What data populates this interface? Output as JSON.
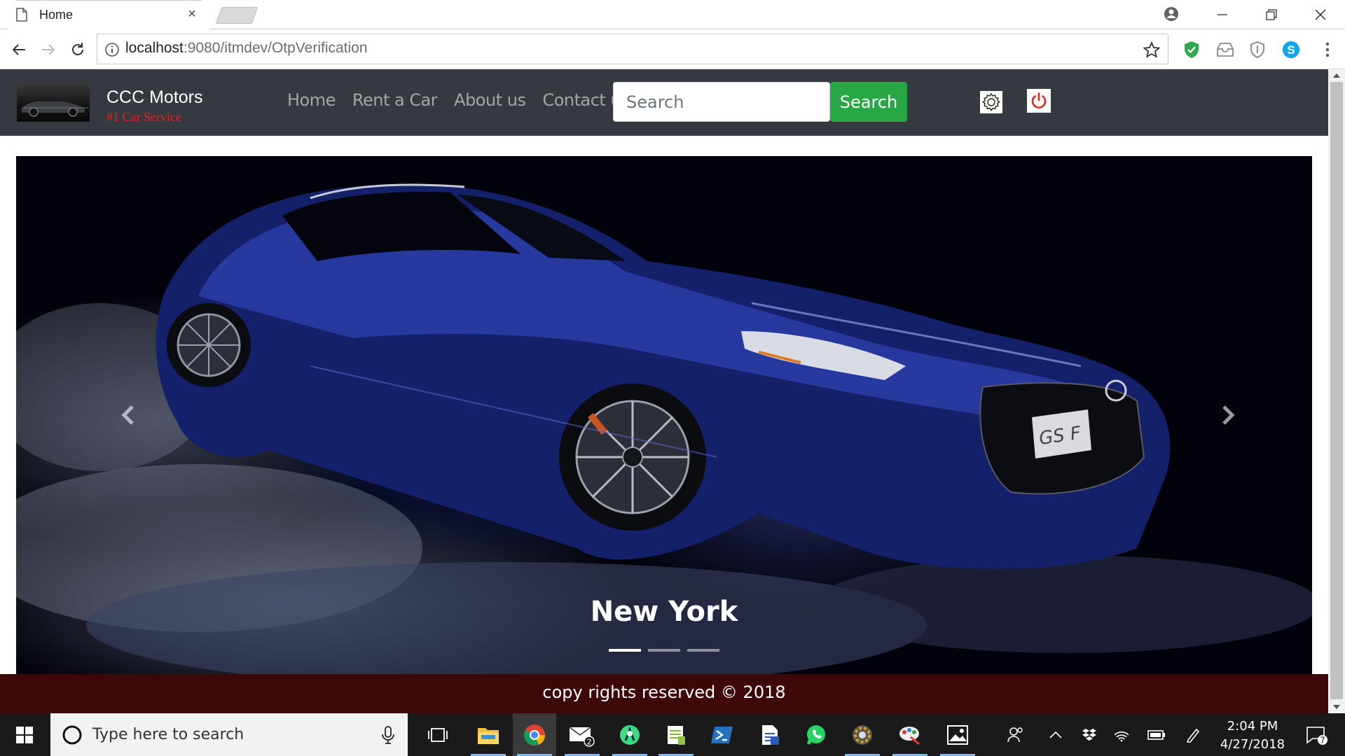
{
  "browser": {
    "tab_title": "Home",
    "tab_close": "×",
    "url_host": "localhost",
    "url_rest": ":9080/itmdev/OtpVerification"
  },
  "site": {
    "brand_name": "CCC Motors",
    "brand_tagline": "#1 Car Service",
    "nav": [
      "Home",
      "Rent a Car",
      "About us",
      "Contact us"
    ],
    "search_placeholder": "Search",
    "search_button": "Search",
    "carousel": {
      "caption": "New York",
      "slides": 3,
      "active_slide": 1,
      "plate_text": "GS F"
    },
    "footer": "copy rights reserved © 2018"
  },
  "taskbar": {
    "search_placeholder": "Type here to search",
    "mail_badge": "2",
    "time": "2:04 PM",
    "date": "4/27/2018",
    "notifications": "7"
  },
  "colors": {
    "navbar": "#343a40",
    "search_button": "#28a745",
    "tagline": "#e0261e",
    "footer": "#3f0808",
    "power_icon": "#e0261e"
  }
}
